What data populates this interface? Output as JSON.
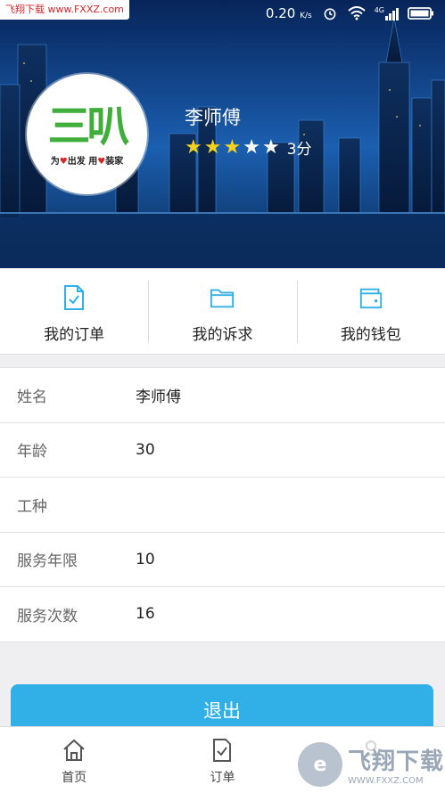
{
  "watermark_top": "飞翔下载 www.FXXZ.com",
  "status_bar": {
    "speed": "0.20",
    "speed_unit": "K/s",
    "network": "4G"
  },
  "profile": {
    "name": "李师傅",
    "rating_value": 3,
    "rating_max": 5,
    "rating_text": "3分",
    "logo_text": "三叭",
    "logo_slogan_1": "为",
    "logo_slogan_2": "出发",
    "logo_slogan_3": "用",
    "logo_slogan_4": "装家"
  },
  "quick_menu": [
    {
      "label": "我的订单",
      "icon": "order-doc-icon"
    },
    {
      "label": "我的诉求",
      "icon": "folder-icon"
    },
    {
      "label": "我的钱包",
      "icon": "wallet-icon"
    }
  ],
  "info_rows": [
    {
      "label": "姓名",
      "value": "李师傅"
    },
    {
      "label": "年龄",
      "value": "30"
    },
    {
      "label": "工种",
      "value": ""
    },
    {
      "label": "服务年限",
      "value": "10"
    },
    {
      "label": "服务次数",
      "value": "16"
    }
  ],
  "logout_label": "退出",
  "bottom_nav": [
    {
      "label": "首页",
      "icon": "home-icon"
    },
    {
      "label": "订单",
      "icon": "order-doc-icon"
    },
    {
      "label": "",
      "icon": "user-icon"
    }
  ],
  "watermark_br": {
    "main": "飞翔下载",
    "sub": "WWW.FXXZ.COM"
  },
  "colors": {
    "accent": "#31b0e8",
    "star": "#f5d21a",
    "hero_bg": "#0d3c86"
  }
}
